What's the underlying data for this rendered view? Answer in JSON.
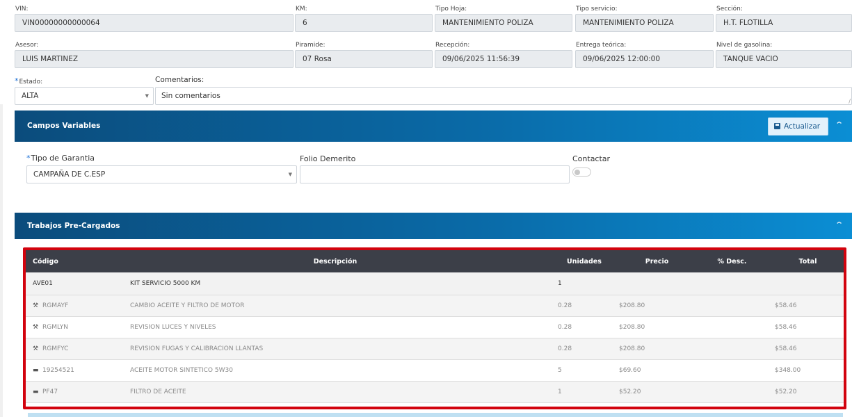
{
  "fields_row1": [
    {
      "label": "VIN:",
      "value": "VIN00000000000064"
    },
    {
      "label": "KM:",
      "value": "6"
    },
    {
      "label": "Tipo Hoja:",
      "value": "MANTENIMIENTO POLIZA"
    },
    {
      "label": "Tipo servicio:",
      "value": "MANTENIMIENTO POLIZA"
    },
    {
      "label": "Sección:",
      "value": "H.T. FLOTILLA"
    }
  ],
  "fields_row2": [
    {
      "label": "Asesor:",
      "value": "LUIS MARTINEZ"
    },
    {
      "label": "Piramide:",
      "value": "07 Rosa"
    },
    {
      "label": "Recepción:",
      "value": "09/06/2025 11:56:39"
    },
    {
      "label": "Entrega teórica:",
      "value": "09/06/2025 12:00:00"
    },
    {
      "label": "Nivel de gasolina:",
      "value": "TANQUE VACIO"
    }
  ],
  "estado": {
    "required_mark": "*",
    "label": "Estado:",
    "value": "ALTA"
  },
  "comentarios": {
    "label": "Comentarios:",
    "value": "Sin comentarios"
  },
  "campos_variables": {
    "title": "Campos Variables",
    "button_label": "Actualizar",
    "tipo_garantia": {
      "required_mark": "*",
      "label": "Tipo de Garantia",
      "value": "CAMPAÑA DE C.ESP"
    },
    "folio_demerito": {
      "label": "Folio Demerito",
      "value": ""
    },
    "contactar": {
      "label": "Contactar",
      "checked": false
    }
  },
  "trabajos": {
    "title": "Trabajos Pre-Cargados",
    "columns": [
      "Código",
      "Descripción",
      "Unidades",
      "Precio",
      "% Desc.",
      "Total"
    ],
    "rows": [
      {
        "type": "main",
        "icon": "",
        "codigo": "AVE01",
        "descripcion": "KIT SERVICIO 5000 KM",
        "unidades": "1",
        "precio": "",
        "desc": "",
        "total": ""
      },
      {
        "type": "sub",
        "icon": "wrench-icon",
        "codigo": "RGMAYF",
        "descripcion": "CAMBIO ACEITE Y FILTRO DE MOTOR",
        "unidades": "0.28",
        "precio": "$208.80",
        "desc": "",
        "total": "$58.46"
      },
      {
        "type": "sub",
        "icon": "wrench-icon",
        "codigo": "RGMLYN",
        "descripcion": "REVISION LUCES Y NIVELES",
        "unidades": "0.28",
        "precio": "$208.80",
        "desc": "",
        "total": "$58.46"
      },
      {
        "type": "sub",
        "icon": "wrench-icon",
        "codigo": "RGMFYC",
        "descripcion": "REVISION FUGAS Y CALIBRACION LLANTAS",
        "unidades": "0.28",
        "precio": "$208.80",
        "desc": "",
        "total": "$58.46"
      },
      {
        "type": "sub",
        "icon": "part-icon",
        "codigo": "19254521",
        "descripcion": "ACEITE MOTOR SINTETICO 5W30",
        "unidades": "5",
        "precio": "$69.60",
        "desc": "",
        "total": "$348.00"
      },
      {
        "type": "sub",
        "icon": "part-icon",
        "codigo": "PF47",
        "descripcion": "FILTRO DE ACEITE",
        "unidades": "1",
        "precio": "$52.20",
        "desc": "",
        "total": "$52.20"
      }
    ]
  },
  "colors": {
    "header_dark": "#0b4c7c",
    "header_light": "#0b8ed4",
    "highlight_border": "#d2030e",
    "table_header": "#3c3f48"
  }
}
